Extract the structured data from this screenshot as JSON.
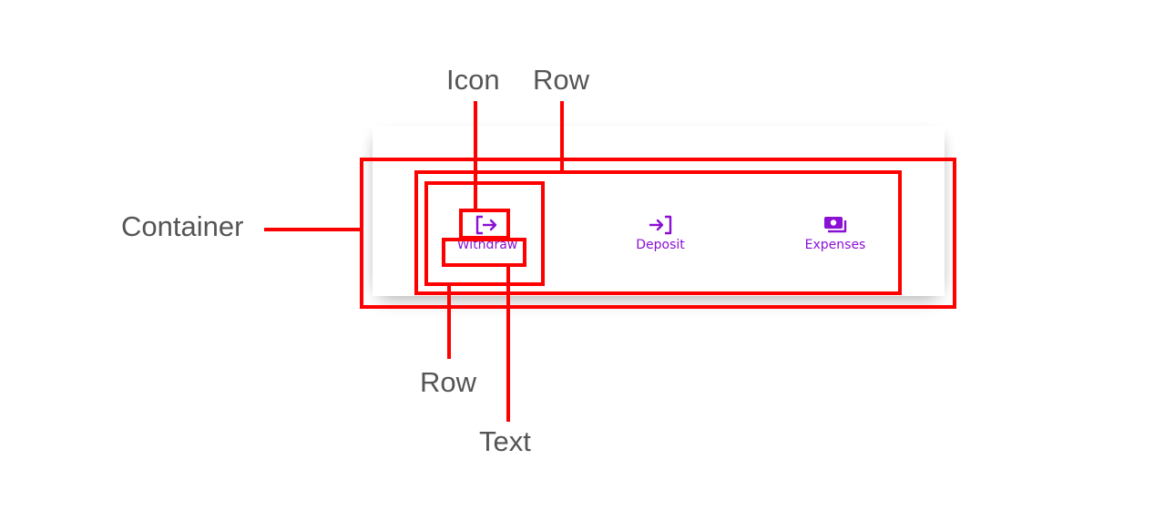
{
  "actions": [
    {
      "label": "Withdraw",
      "icon": "withdraw-icon"
    },
    {
      "label": "Deposit",
      "icon": "deposit-icon"
    },
    {
      "label": "Expenses",
      "icon": "expenses-icon"
    }
  ],
  "annotations": {
    "icon": "Icon",
    "row_outer": "Row",
    "container": "Container",
    "row_inner": "Row",
    "text": "Text"
  },
  "colors": {
    "accent": "#8a10d4",
    "annotation": "#ff0000",
    "callout_text": "#555555"
  }
}
